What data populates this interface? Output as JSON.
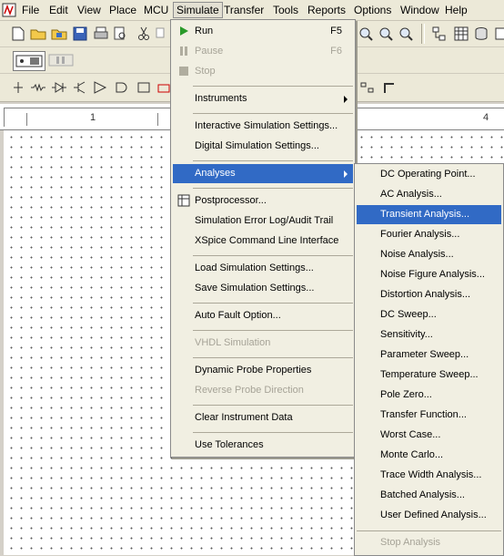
{
  "menubar": {
    "items": [
      "File",
      "Edit",
      "View",
      "Place",
      "MCU",
      "Simulate",
      "Transfer",
      "Tools",
      "Reports",
      "Options",
      "Window",
      "Help"
    ],
    "active": "Simulate"
  },
  "ruler": {
    "labels": [
      "1",
      "4"
    ]
  },
  "simulate_menu": {
    "run": {
      "label": "Run",
      "shortcut": "F5"
    },
    "pause": {
      "label": "Pause",
      "shortcut": "F6"
    },
    "stop": {
      "label": "Stop"
    },
    "instruments": "Instruments",
    "interactive_settings": "Interactive Simulation Settings...",
    "digital_settings": "Digital Simulation Settings...",
    "analyses": "Analyses",
    "postprocessor": "Postprocessor...",
    "error_log": "Simulation Error Log/Audit Trail",
    "xspice": "XSpice Command Line Interface",
    "load_settings": "Load Simulation Settings...",
    "save_settings": "Save Simulation Settings...",
    "auto_fault": "Auto Fault Option...",
    "vhdl": "VHDL Simulation",
    "dynamic_probe": "Dynamic Probe Properties",
    "reverse_probe": "Reverse Probe Direction",
    "clear_instrument": "Clear Instrument Data",
    "use_tolerances": "Use Tolerances"
  },
  "analyses_menu": {
    "items": [
      "DC Operating Point...",
      "AC Analysis...",
      "Transient Analysis...",
      "Fourier Analysis...",
      "Noise Analysis...",
      "Noise Figure Analysis...",
      "Distortion Analysis...",
      "DC Sweep...",
      "Sensitivity...",
      "Parameter Sweep...",
      "Temperature Sweep...",
      "Pole Zero...",
      "Transfer Function...",
      "Worst Case...",
      "Monte Carlo...",
      "Trace Width Analysis...",
      "Batched Analysis...",
      "User Defined Analysis..."
    ],
    "stop_analysis": "Stop Analysis",
    "highlighted": "Transient Analysis..."
  },
  "colors": {
    "highlight": "#316ac5",
    "menu_bg": "#f1efe2",
    "disabled": "#a6a397"
  }
}
